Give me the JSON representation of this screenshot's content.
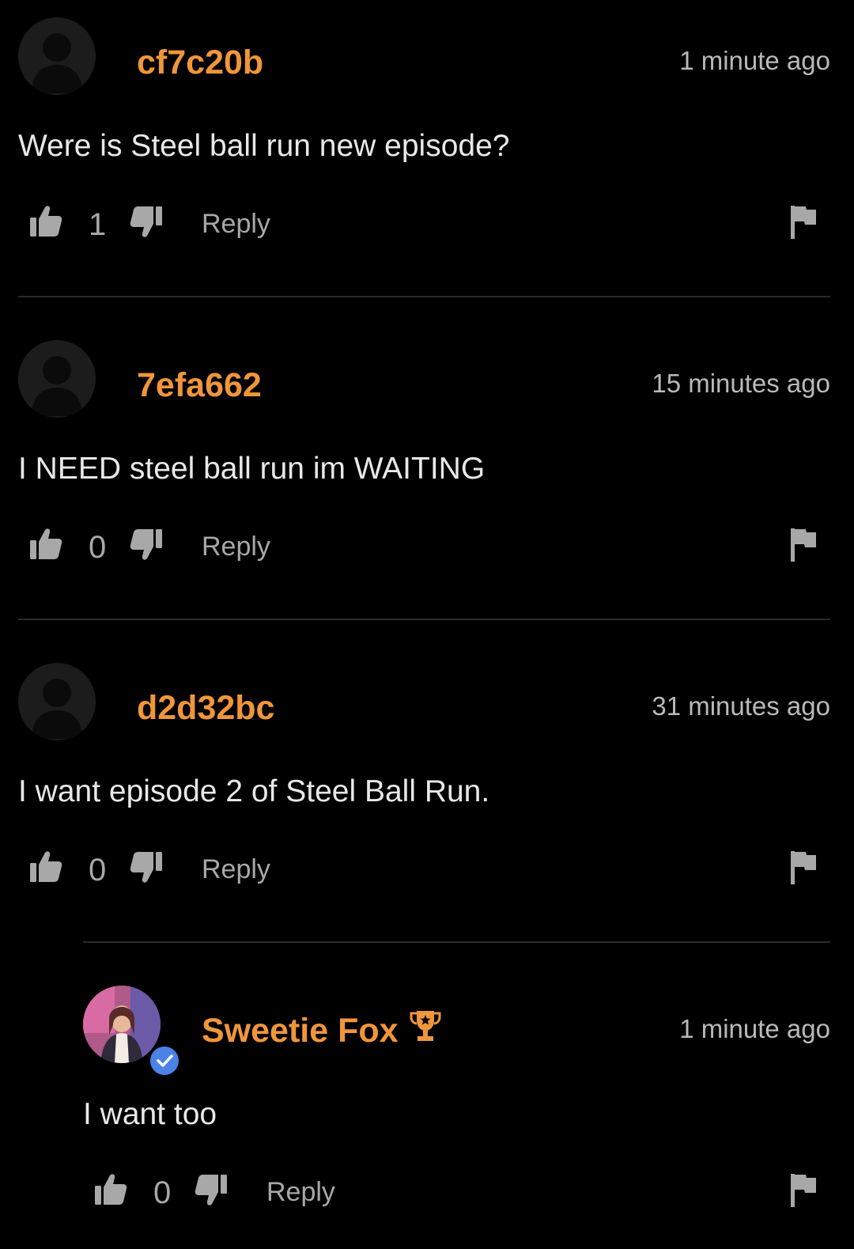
{
  "comments": [
    {
      "username": "cf7c20b",
      "timestamp": "1 minute ago",
      "text": "Were is Steel ball run new episode?",
      "likes": "1",
      "reply_label": "Reply",
      "avatar": "default-user-icon"
    },
    {
      "username": "7efa662",
      "timestamp": "15 minutes ago",
      "text": "I NEED steel ball run im WAITING",
      "likes": "0",
      "reply_label": "Reply",
      "avatar": "default-user-icon"
    },
    {
      "username": "d2d32bc",
      "timestamp": "31 minutes ago",
      "text": "I want episode 2 of Steel Ball Run.",
      "likes": "0",
      "reply_label": "Reply",
      "avatar": "default-user-icon"
    }
  ],
  "reply": {
    "username": "Sweetie Fox",
    "timestamp": "1 minute ago",
    "text": "I want too",
    "likes": "0",
    "reply_label": "Reply",
    "avatar": "profile-photo",
    "verified": true,
    "badge": "trophy-icon"
  },
  "colors": {
    "background": "#000000",
    "username": "#f0963a",
    "text": "#e8e8e8",
    "muted": "#a8a8a8",
    "divider": "#2a2a2a",
    "verified": "#4a82e6"
  }
}
